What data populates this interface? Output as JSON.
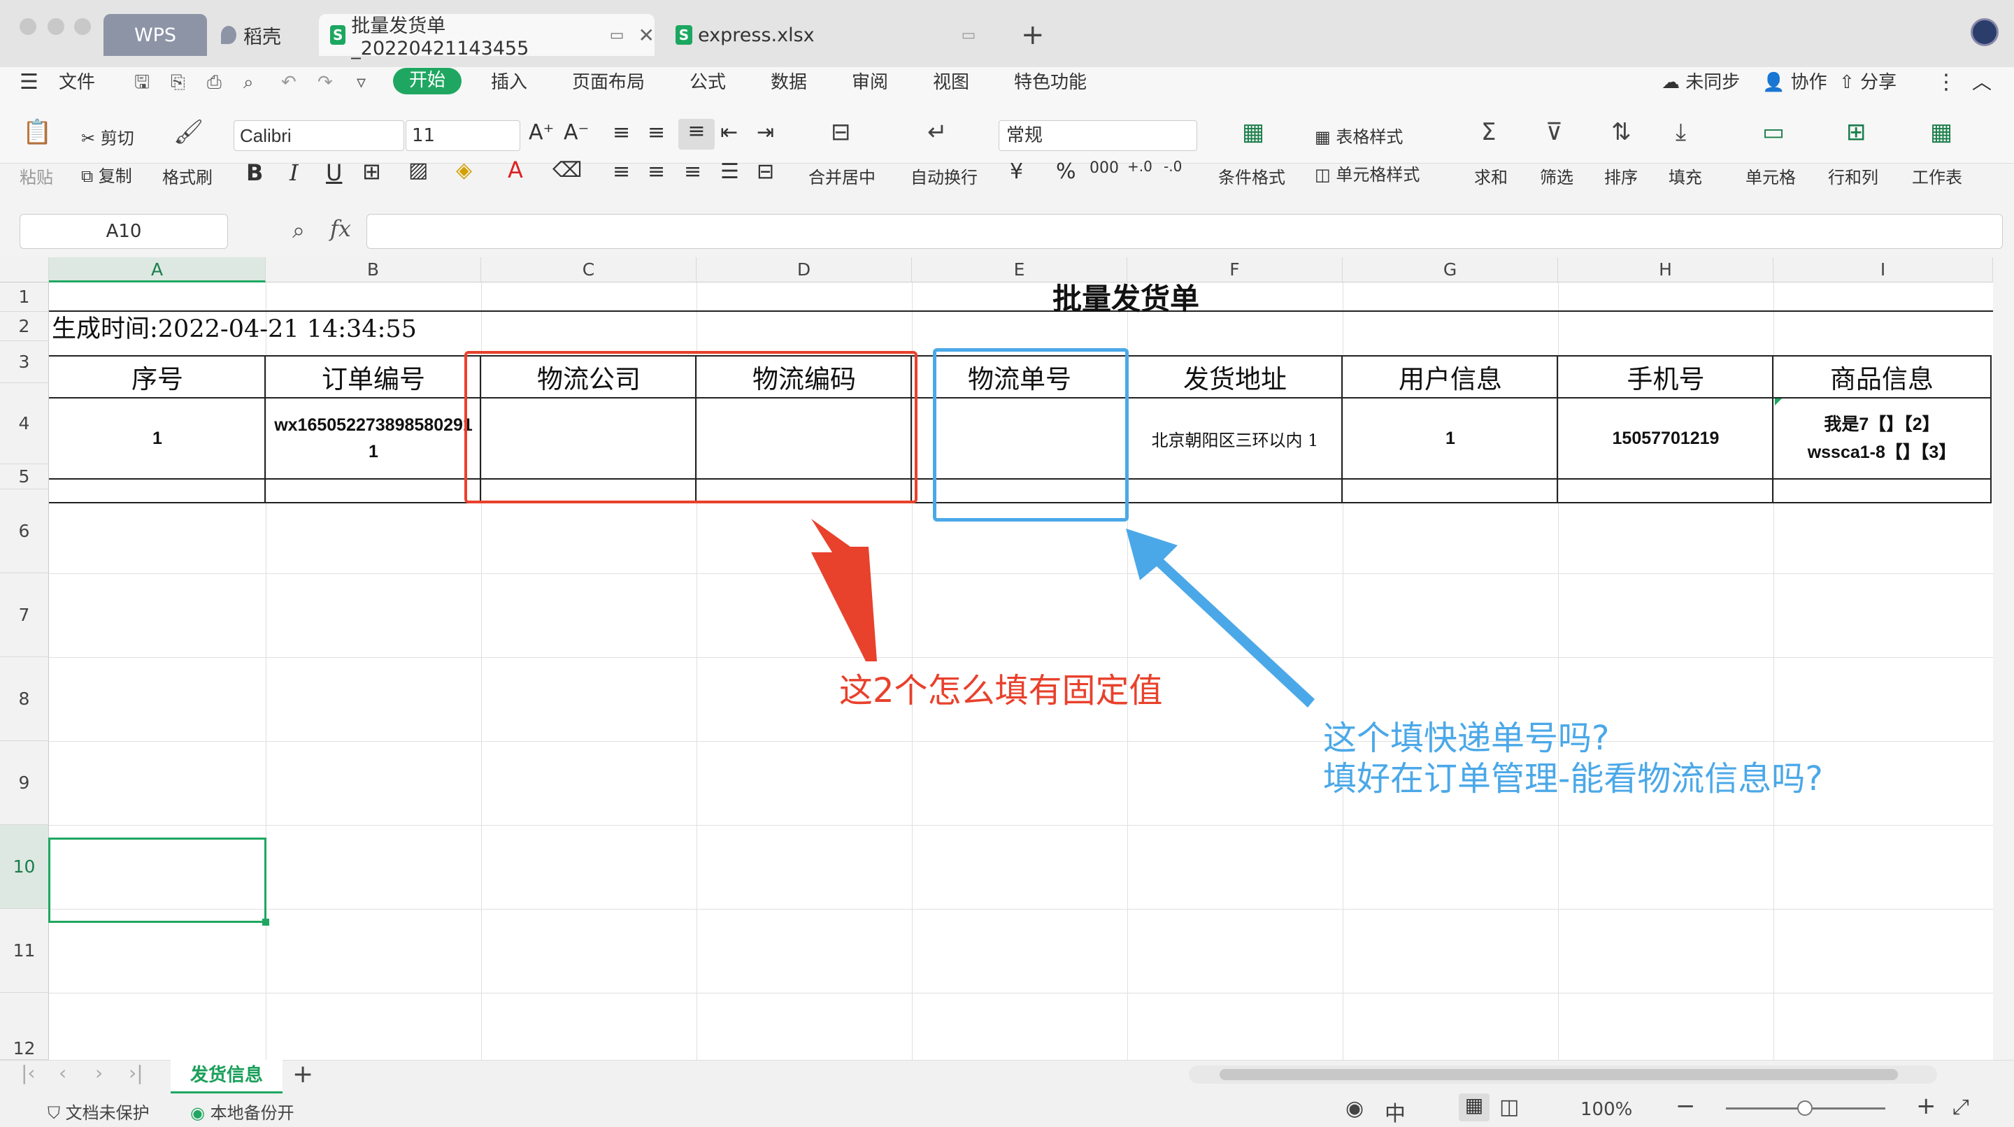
{
  "tabs": {
    "wps": "WPS",
    "daoke": "稻壳",
    "doc": "批量发货单_20220421143455",
    "express": "express.xlsx",
    "add": "+"
  },
  "menu": {
    "file": "文件",
    "start": "开始",
    "insert": "插入",
    "layout": "页面布局",
    "formula": "公式",
    "data": "数据",
    "review": "审阅",
    "view": "视图",
    "special": "特色功能",
    "unsync": "未同步",
    "collab": "协作",
    "share": "分享"
  },
  "ribbon": {
    "paste": "粘贴",
    "cut": "剪切",
    "copy": "复制",
    "format_painter": "格式刷",
    "font_name": "Calibri",
    "font_size": "11",
    "merge": "合并居中",
    "wrap": "自动换行",
    "number_format": "常规",
    "cond_format": "条件格式",
    "table_style": "表格样式",
    "cell_style": "单元格样式",
    "sum": "求和",
    "filter": "筛选",
    "sort": "排序",
    "fill": "填充",
    "cells": "单元格",
    "rowcol": "行和列",
    "worksheet": "工作表"
  },
  "formula_bar": {
    "name_box": "A10",
    "fx": "fx",
    "value": ""
  },
  "columns": [
    "A",
    "B",
    "C",
    "D",
    "E",
    "F",
    "G",
    "H",
    "I"
  ],
  "rows": [
    "1",
    "2",
    "3",
    "4",
    "5",
    "6",
    "7",
    "8",
    "9",
    "10",
    "11",
    "12"
  ],
  "sheet": {
    "title": "批量发货单",
    "gen_time": "生成时间:2022-04-21 14:34:55",
    "headers": [
      "序号",
      "订单编号",
      "物流公司",
      "物流编码",
      "物流单号",
      "发货地址",
      "用户信息",
      "手机号",
      "商品信息"
    ],
    "row4": {
      "seq": "1",
      "order_line1": "wx165052273898580291",
      "order_line2": "1",
      "logistics_company": "",
      "logistics_code": "",
      "tracking_no": "",
      "address": "北京朝阳区三环以内 1",
      "user": "1",
      "phone": "15057701219",
      "goods_line1": "我是7【】【2】",
      "goods_line2": "wssca1-8【】【3】"
    }
  },
  "annotations": {
    "red_text": "这2个怎么填有固定值",
    "blue_line1": "这个填快递单号吗?",
    "blue_line2": "填好在订单管理-能看物流信息吗?",
    "red_color": "#e8412c",
    "blue_color": "#4ba8e8"
  },
  "sheet_tabs": {
    "active": "发货信息",
    "add": "+"
  },
  "status": {
    "protect": "文档未保护",
    "backup": "本地备份开",
    "zoom": "100%"
  }
}
